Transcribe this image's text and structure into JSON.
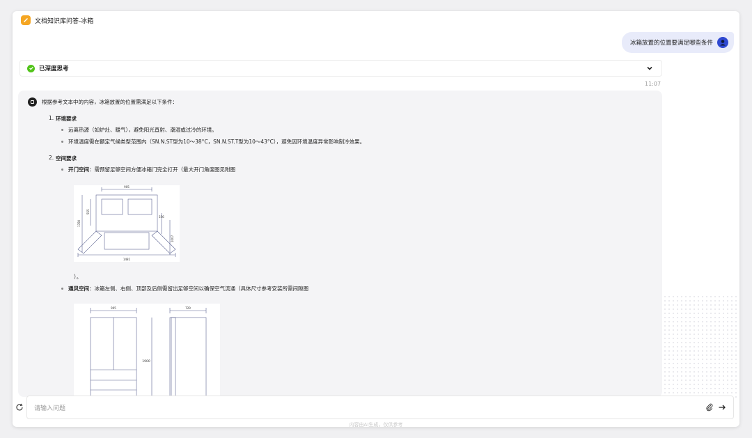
{
  "app": {
    "title": "文档知识库问答-冰箱"
  },
  "user_message": {
    "text": "冰箱放置的位置要满足哪些条件"
  },
  "thinking": {
    "label": "已深度思考"
  },
  "timestamp": "11:07",
  "answer": {
    "intro": "根据参考文本中的内容，冰箱放置的位置需满足以下条件：",
    "section1": {
      "number": "1.",
      "title": "环境要求",
      "bullets": [
        "远离热源（如炉灶、暖气），避免阳光直射、潮湿或过冷的环境。",
        "环境温度需在额定气候类型范围内（SN.N.ST型为10～38°C，SN.N.ST.T型为10～43°C），避免因环境温度异常影响制冷效果。"
      ]
    },
    "section2": {
      "number": "2.",
      "title": "空间要求",
      "b1_bold": "开门空间",
      "b1_text": "：需预留足够空间方便冰箱门完全打开（最大开门角度图见附图",
      "b1_tail": "）。",
      "b2_bold": "通风空间",
      "b2_text": "：冰箱左侧、右侧、顶部及后侧需留出足够空间以确保空气流通（具体尺寸参考安装所需间隙图"
    },
    "diagram1": {
      "top": "905",
      "left_outer": "1780",
      "left_inner": "555",
      "right_inner": "556",
      "right_outer": "1007",
      "bottom": "1481"
    },
    "diagram2": {
      "top_left": "905",
      "top_right": "729",
      "height": "1900"
    }
  },
  "input": {
    "placeholder": "请输入问题"
  },
  "footer": "内容由AI生成，仅供参考"
}
